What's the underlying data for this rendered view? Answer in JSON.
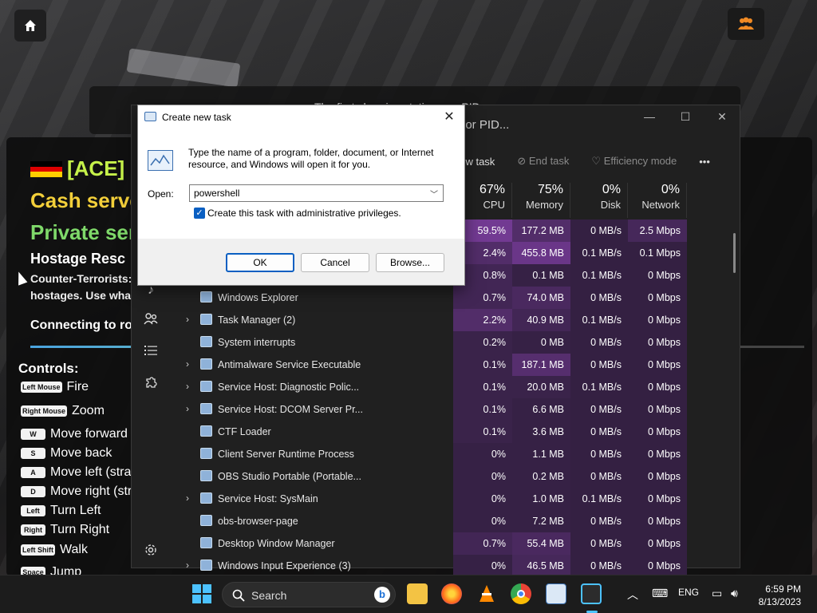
{
  "background": {
    "banner_text": "The first charging stations, or PID...",
    "server_name": "[ACE] (",
    "cash_text": "Cash serve",
    "private_text": "Private ser",
    "mode_text": "Hostage Resc",
    "desc_line1": "Counter-Terrorists:",
    "desc_line2": "hostages. Use what",
    "connecting_text": "Connecting to ro",
    "progress": 0.9,
    "controls_title": "Controls:",
    "controls": [
      {
        "key": "Left Mouse",
        "action": "Fire"
      },
      {
        "key": "Right Mouse",
        "action": "Zoom"
      },
      {
        "key": "W",
        "action": "Move forward"
      },
      {
        "key": "S",
        "action": "Move back"
      },
      {
        "key": "A",
        "action": "Move left (stra"
      },
      {
        "key": "D",
        "action": "Move right (str"
      },
      {
        "key": "Left",
        "action": "Turn Left"
      },
      {
        "key": "Right",
        "action": "Turn Right"
      },
      {
        "key": "Left Shift",
        "action": "Walk"
      },
      {
        "key": "Space",
        "action": "Jump"
      }
    ]
  },
  "task_manager": {
    "search_text": ", or PID...",
    "toolbar": {
      "run_new_task": "new task",
      "end_task": "End task",
      "efficiency_mode": "Efficiency mode",
      "more": "•••"
    },
    "columns": [
      {
        "pct": "67%",
        "label": "CPU"
      },
      {
        "pct": "75%",
        "label": "Memory"
      },
      {
        "pct": "0%",
        "label": "Disk"
      },
      {
        "pct": "0%",
        "label": "Network"
      }
    ],
    "rows": [
      {
        "name": "",
        "cpu": "59.5%",
        "mem": "177.2 MB",
        "disk": "0 MB/s",
        "net": "2.5 Mbps",
        "expand": false,
        "cpu_heat": 0.9,
        "mem_heat": 0.5
      },
      {
        "name": "",
        "cpu": "2.4%",
        "mem": "455.8 MB",
        "disk": "0.1 MB/s",
        "net": "0.1 Mbps",
        "expand": false,
        "cpu_heat": 0.5,
        "mem_heat": 0.8
      },
      {
        "name": "",
        "cpu": "0.8%",
        "mem": "0.1 MB",
        "disk": "0.1 MB/s",
        "net": "0 Mbps",
        "expand": false,
        "cpu_heat": 0.3,
        "mem_heat": 0.15
      },
      {
        "name": "Windows Explorer",
        "cpu": "0.7%",
        "mem": "74.0 MB",
        "disk": "0 MB/s",
        "net": "0 Mbps",
        "expand": false,
        "cpu_heat": 0.3,
        "mem_heat": 0.4
      },
      {
        "name": "Task Manager (2)",
        "cpu": "2.2%",
        "mem": "40.9 MB",
        "disk": "0.1 MB/s",
        "net": "0 Mbps",
        "expand": true,
        "cpu_heat": 0.5,
        "mem_heat": 0.3
      },
      {
        "name": "System interrupts",
        "cpu": "0.2%",
        "mem": "0 MB",
        "disk": "0 MB/s",
        "net": "0 Mbps",
        "expand": false,
        "cpu_heat": 0.2,
        "mem_heat": 0.15
      },
      {
        "name": "Antimalware Service Executable",
        "cpu": "0.1%",
        "mem": "187.1 MB",
        "disk": "0 MB/s",
        "net": "0 Mbps",
        "expand": true,
        "cpu_heat": 0.2,
        "mem_heat": 0.55
      },
      {
        "name": "Service Host: Diagnostic Polic...",
        "cpu": "0.1%",
        "mem": "20.0 MB",
        "disk": "0.1 MB/s",
        "net": "0 Mbps",
        "expand": true,
        "cpu_heat": 0.2,
        "mem_heat": 0.2
      },
      {
        "name": "Service Host: DCOM Server Pr...",
        "cpu": "0.1%",
        "mem": "6.6 MB",
        "disk": "0 MB/s",
        "net": "0 Mbps",
        "expand": true,
        "cpu_heat": 0.2,
        "mem_heat": 0.15
      },
      {
        "name": "CTF Loader",
        "cpu": "0.1%",
        "mem": "3.6 MB",
        "disk": "0 MB/s",
        "net": "0 Mbps",
        "expand": false,
        "cpu_heat": 0.2,
        "mem_heat": 0.15
      },
      {
        "name": "Client Server Runtime Process",
        "cpu": "0%",
        "mem": "1.1 MB",
        "disk": "0 MB/s",
        "net": "0 Mbps",
        "expand": false,
        "cpu_heat": 0.15,
        "mem_heat": 0.15
      },
      {
        "name": "OBS Studio Portable (Portable...",
        "cpu": "0%",
        "mem": "0.2 MB",
        "disk": "0 MB/s",
        "net": "0 Mbps",
        "expand": false,
        "cpu_heat": 0.15,
        "mem_heat": 0.15
      },
      {
        "name": "Service Host: SysMain",
        "cpu": "0%",
        "mem": "1.0 MB",
        "disk": "0.1 MB/s",
        "net": "0 Mbps",
        "expand": true,
        "cpu_heat": 0.15,
        "mem_heat": 0.15
      },
      {
        "name": "obs-browser-page",
        "cpu": "0%",
        "mem": "7.2 MB",
        "disk": "0 MB/s",
        "net": "0 Mbps",
        "expand": false,
        "cpu_heat": 0.15,
        "mem_heat": 0.15
      },
      {
        "name": "Desktop Window Manager",
        "cpu": "0.7%",
        "mem": "55.4 MB",
        "disk": "0 MB/s",
        "net": "0 Mbps",
        "expand": false,
        "cpu_heat": 0.3,
        "mem_heat": 0.4
      },
      {
        "name": "Windows Input Experience (3)",
        "cpu": "0%",
        "mem": "46.5 MB",
        "disk": "0 MB/s",
        "net": "0 Mbps",
        "expand": true,
        "cpu_heat": 0.15,
        "mem_heat": 0.35
      }
    ]
  },
  "run_dialog": {
    "title": "Create new task",
    "message": "Type the name of a program, folder, document, or Internet resource, and Windows will open it for you.",
    "open_label": "Open:",
    "open_value": "powershell",
    "admin_label": "Create this task with administrative privileges.",
    "admin_checked": true,
    "ok_label": "OK",
    "cancel_label": "Cancel",
    "browse_label": "Browse..."
  },
  "taskbar": {
    "search_label": "Search",
    "language": "ENG",
    "time": "6:59 PM",
    "date": "8/13/2023"
  },
  "colors": {
    "heat_base": "#3c1f52",
    "heat_strong": "#7a3d9c",
    "accent": "#0a5fc2"
  }
}
